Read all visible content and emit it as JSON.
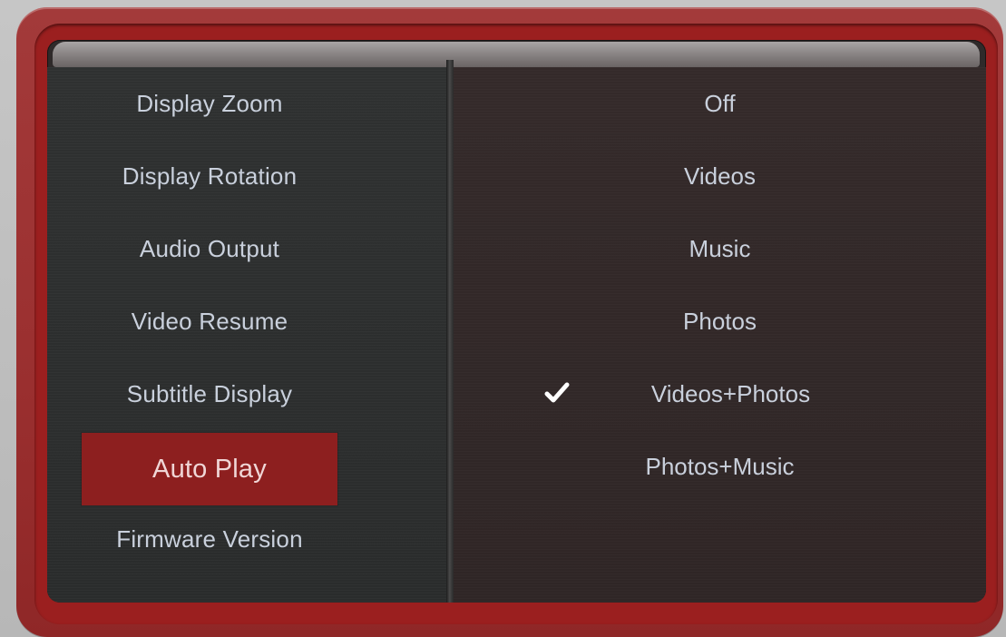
{
  "settings_menu": {
    "items": [
      {
        "label": "Display Zoom"
      },
      {
        "label": "Display Rotation"
      },
      {
        "label": "Audio Output"
      },
      {
        "label": "Video Resume"
      },
      {
        "label": "Subtitle Display"
      },
      {
        "label": "Auto Play",
        "selected": true
      },
      {
        "label": "Firmware Version"
      }
    ]
  },
  "auto_play_options": {
    "items": [
      {
        "label": "Off"
      },
      {
        "label": "Videos"
      },
      {
        "label": "Music"
      },
      {
        "label": "Photos"
      },
      {
        "label": "Videos+Photos",
        "checked": true,
        "icon": "checkmark-icon"
      },
      {
        "label": "Photos+Music"
      }
    ]
  },
  "colors": {
    "frame_red": "#9b1f1f",
    "selection_red": "#8d1f1f",
    "text": "#c9d0dc",
    "check": "#ffffff"
  }
}
